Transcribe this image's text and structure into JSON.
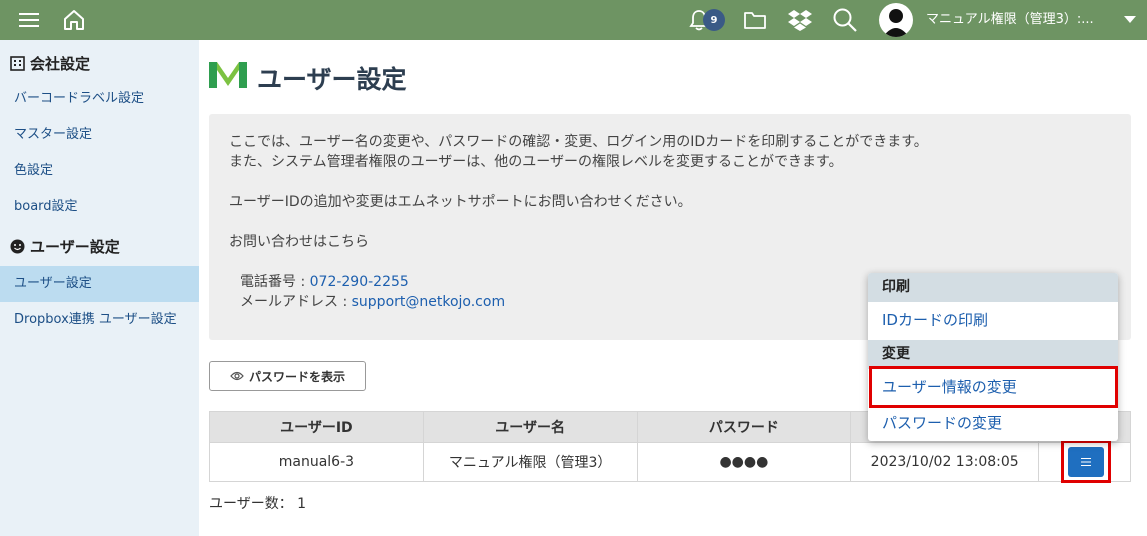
{
  "topbar": {
    "notification_count": "9",
    "user_name": "マニュアル権限（管理3）:..."
  },
  "sidebar": {
    "company_heading": "会社設定",
    "company_items": [
      "バーコードラベル設定",
      "マスター設定",
      "色設定",
      "board設定"
    ],
    "user_heading": "ユーザー設定",
    "user_items": [
      "ユーザー設定",
      "Dropbox連携 ユーザー設定"
    ]
  },
  "page": {
    "title": "ユーザー設定",
    "info_lines": [
      "ここでは、ユーザー名の変更や、パスワードの確認・変更、ログイン用のIDカードを印刷することができます。",
      "また、システム管理者権限のユーザーは、他のユーザーの権限レベルを変更することができます。",
      "ユーザーIDの追加や変更はエムネットサポートにお問い合わせください。",
      "お問い合わせはこちら"
    ],
    "phone_label": "電話番号 : ",
    "phone": "072-290-2255",
    "email_label": "メールアドレス : ",
    "email": "support@netkojo.com",
    "show_password_label": "パスワードを表示",
    "user_count_label": "ユーザー数： 1"
  },
  "table": {
    "headers": [
      "ユーザーID",
      "ユーザー名",
      "パスワード",
      "",
      ""
    ],
    "row": [
      "manual6-3",
      "マニュアル権限（管理3）",
      "●●●●",
      "2023/10/02 13:08:05"
    ]
  },
  "dropdown": {
    "print_heading": "印刷",
    "print_item": "IDカードの印刷",
    "change_heading": "変更",
    "change_items": [
      "ユーザー情報の変更",
      "パスワードの変更"
    ]
  },
  "colors": {
    "topbar": "#6e9463",
    "sidebar": "#e9f1f7",
    "active": "#bcdcf0",
    "accent": "#1f6fc0",
    "highlight": "#e00000"
  }
}
